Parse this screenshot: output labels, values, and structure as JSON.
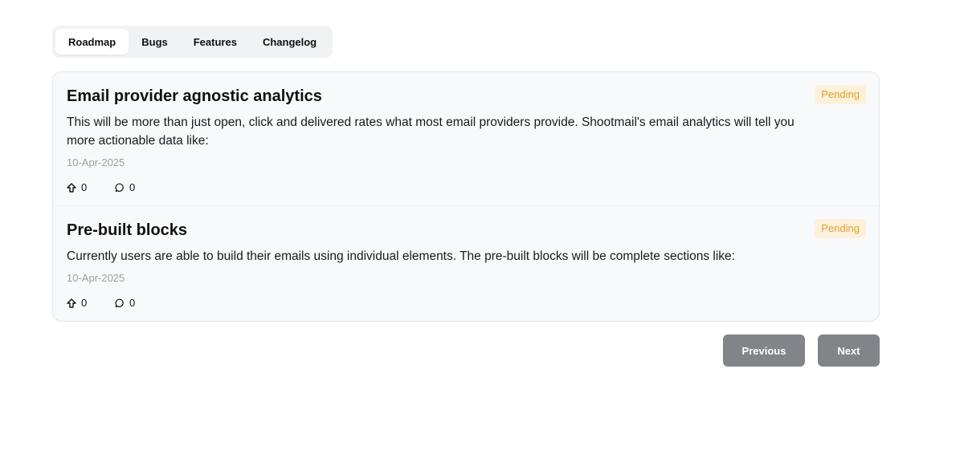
{
  "tabs": [
    {
      "label": "Roadmap",
      "active": true
    },
    {
      "label": "Bugs",
      "active": false
    },
    {
      "label": "Features",
      "active": false
    },
    {
      "label": "Changelog",
      "active": false
    }
  ],
  "items": [
    {
      "title": "Email provider agnostic analytics",
      "status": "Pending",
      "description": "This will be more than just open, click and delivered rates what most email providers provide. Shootmail's email analytics will tell you more actionable data like:",
      "date": "10-Apr-2025",
      "upvotes": "0",
      "comments": "0"
    },
    {
      "title": "Pre-built blocks",
      "status": "Pending",
      "description": "Currently users are able to build their emails using individual elements. The pre-built blocks will be complete sections like:",
      "date": "10-Apr-2025",
      "upvotes": "0",
      "comments": "0"
    }
  ],
  "pagination": {
    "previous_label": "Previous",
    "next_label": "Next"
  },
  "colors": {
    "status_bg": "#fdf1dc",
    "status_text": "#e0a02a",
    "button_bg": "#838489"
  }
}
